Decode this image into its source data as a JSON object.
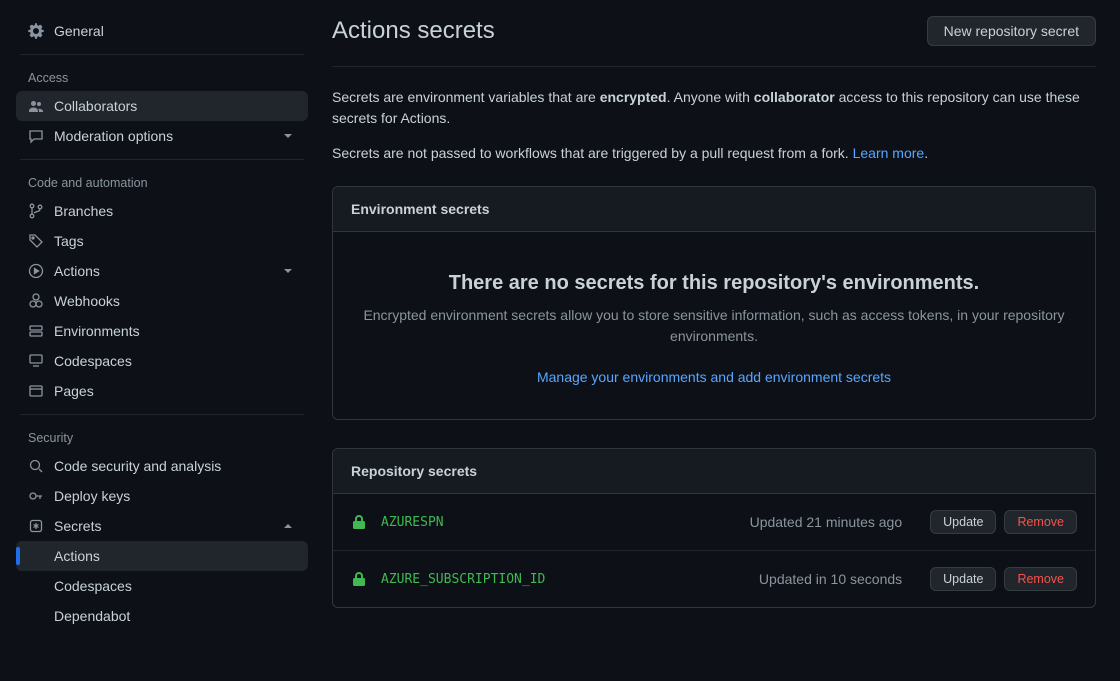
{
  "sidebar": {
    "general": "General",
    "groups": {
      "access": {
        "title": "Access",
        "collaborators": "Collaborators",
        "moderation": "Moderation options"
      },
      "code": {
        "title": "Code and automation",
        "branches": "Branches",
        "tags": "Tags",
        "actions": "Actions",
        "webhooks": "Webhooks",
        "environments": "Environments",
        "codespaces": "Codespaces",
        "pages": "Pages"
      },
      "security": {
        "title": "Security",
        "codesec": "Code security and analysis",
        "deploykeys": "Deploy keys",
        "secrets": "Secrets",
        "sub_actions": "Actions",
        "sub_codespaces": "Codespaces",
        "sub_dependabot": "Dependabot"
      }
    }
  },
  "page": {
    "title": "Actions secrets",
    "new_btn": "New repository secret",
    "intro1_a": "Secrets are environment variables that are ",
    "intro1_b": "encrypted",
    "intro1_c": ". Anyone with ",
    "intro1_d": "collaborator",
    "intro1_e": " access to this repository can use these secrets for Actions.",
    "intro2_a": "Secrets are not passed to workflows that are triggered by a pull request from a fork. ",
    "intro2_link": "Learn more",
    "intro2_dot": ".",
    "env_header": "Environment secrets",
    "env_title": "There are no secrets for this repository's environments.",
    "env_sub": "Encrypted environment secrets allow you to store sensitive information, such as access tokens, in your repository environments.",
    "env_link": "Manage your environments and add environment secrets",
    "repo_header": "Repository secrets",
    "update": "Update",
    "remove": "Remove",
    "secrets": [
      {
        "name": "AZURESPN",
        "updated": "Updated 21 minutes ago"
      },
      {
        "name": "AZURE_SUBSCRIPTION_ID",
        "updated": "Updated in 10 seconds"
      }
    ]
  }
}
